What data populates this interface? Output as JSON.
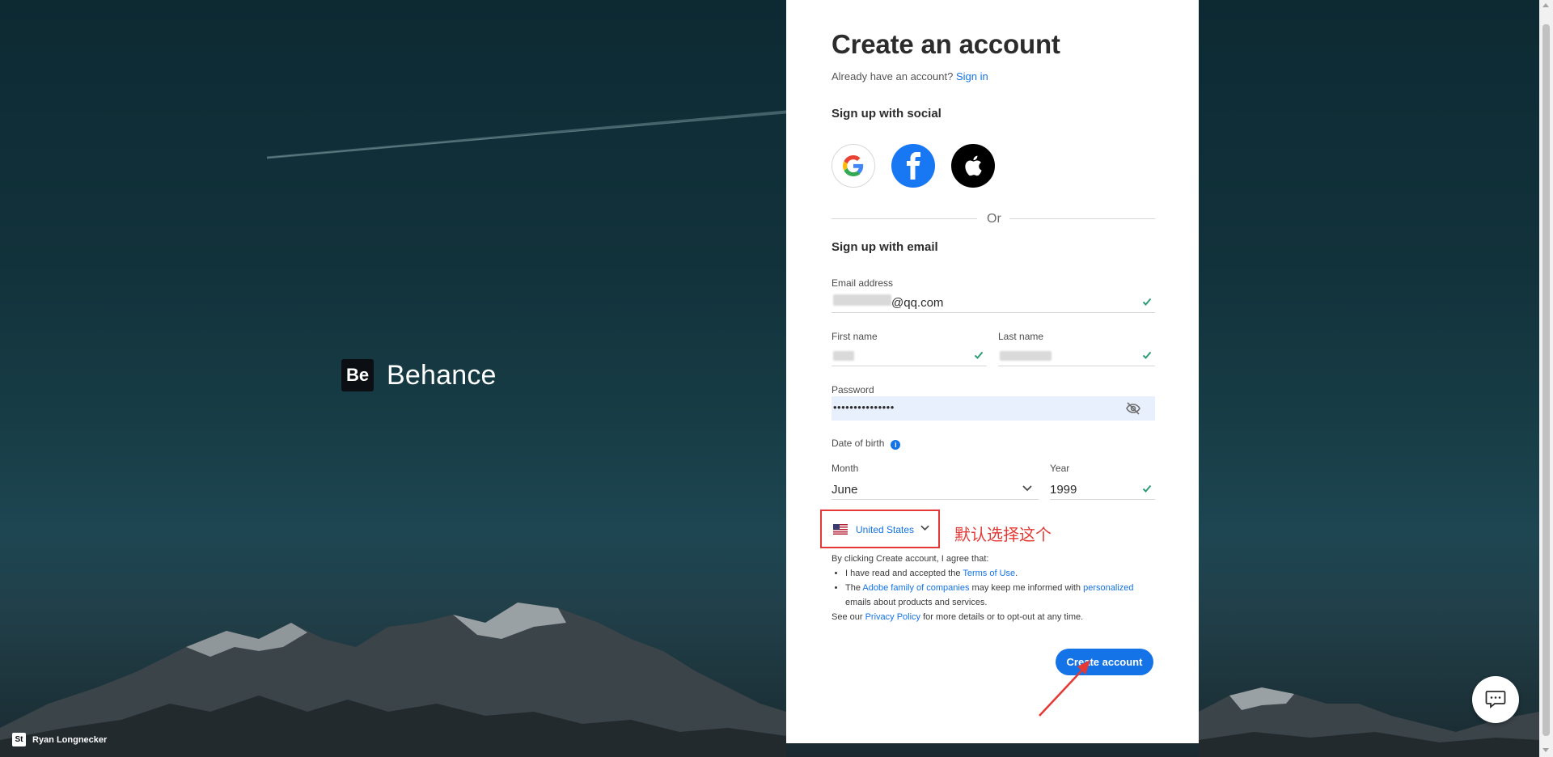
{
  "brand": {
    "logo_text": "Be",
    "name": "Behance"
  },
  "credit": {
    "logo_text": "St",
    "author": "Ryan Longnecker"
  },
  "form": {
    "title": "Create an account",
    "already_text": "Already have an account?",
    "sign_in_label": "Sign in",
    "social_heading": "Sign up with social",
    "social_buttons": [
      {
        "name": "Google",
        "icon": "google-icon"
      },
      {
        "name": "Facebook",
        "icon": "facebook-icon"
      },
      {
        "name": "Apple",
        "icon": "apple-icon"
      }
    ],
    "or_label": "Or",
    "email_heading": "Sign up with email",
    "email": {
      "label": "Email address",
      "value": "@qq.com"
    },
    "first_name": {
      "label": "First name"
    },
    "last_name": {
      "label": "Last name"
    },
    "password": {
      "label": "Password",
      "value": "•••••••••••••••"
    },
    "dob": {
      "label": "Date of birth"
    },
    "month": {
      "label": "Month",
      "value": "June"
    },
    "year": {
      "label": "Year",
      "value": "1999"
    },
    "country": {
      "value": "United States"
    },
    "annotation": "默认选择这个",
    "terms": {
      "intro": "By clicking Create account, I agree that:",
      "item1_pre": "I have read and accepted the ",
      "item1_link": "Terms of Use",
      "item1_post": ".",
      "item2_pre": "The ",
      "item2_link1": "Adobe family of companies",
      "item2_mid": " may keep me informed with ",
      "item2_link2": "personalized",
      "item2_post": " emails about products and services.",
      "privacy_pre": "See our ",
      "privacy_link": "Privacy Policy",
      "privacy_post": " for more details or to opt-out at any time."
    },
    "submit_label": "Create account"
  },
  "colors": {
    "accent": "#1473e6",
    "annotation": "#e53935",
    "check": "#2d9d78",
    "autofill": "#e8f0fe"
  }
}
